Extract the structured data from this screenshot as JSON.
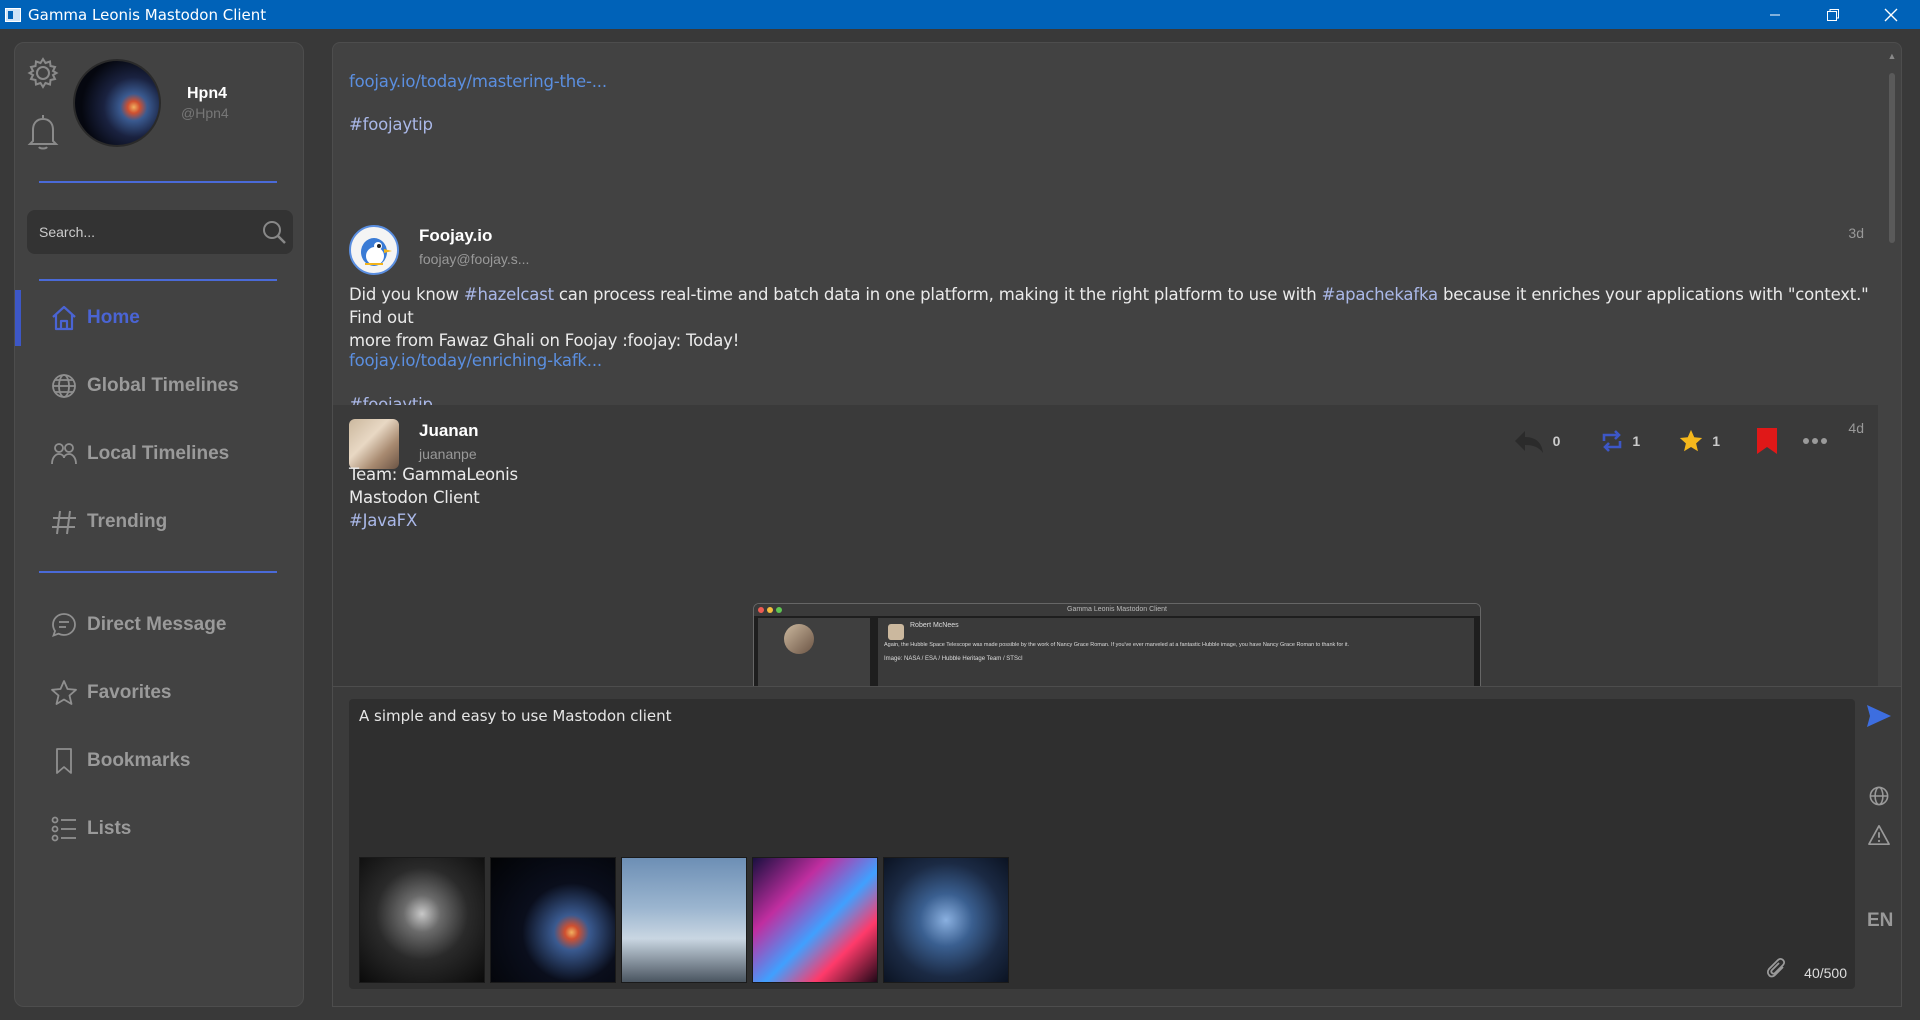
{
  "window": {
    "title": "Gamma Leonis Mastodon Client"
  },
  "profile": {
    "name": "Hpn4",
    "handle": "@Hpn4"
  },
  "search": {
    "placeholder": "Search..."
  },
  "nav": {
    "home": "Home",
    "global": "Global Timelines",
    "local": "Local Timelines",
    "trending": "Trending",
    "dm": "Direct Message",
    "favorites": "Favorites",
    "bookmarks": "Bookmarks",
    "lists": "Lists"
  },
  "posts": [
    {
      "link": "foojay.io/today/mastering-the-...",
      "hashtag": "#foojaytip"
    },
    {
      "name": "Foojay.io",
      "handle": "foojay@foojay.s...",
      "time": "3d",
      "body_1": "Did you know ",
      "tag_1": "#hazelcast",
      "body_2": " can process real-time and batch data in one platform, making it the right platform to use with ",
      "tag_2": "#apachekafka",
      "body_3": " because it enriches your applications with \"context.\" Find out",
      "body_line2": "more from Fawaz Ghali on Foojay :foojay: Today!",
      "link": "foojay.io/today/enriching-kafk...",
      "hashtag": "#foojaytip"
    },
    {
      "name": "Juanan",
      "handle": "juananpe",
      "time": "4d",
      "line1": "Team: GammaLeonis",
      "line2": "Mastodon Client",
      "hashtag": "#JavaFX",
      "replies": "0",
      "boosts": "1",
      "favs": "1",
      "preview": {
        "title": "Gamma Leonis Mastodon Client",
        "author": "Robert McNees",
        "text": "Again, the Hubble Space Telescope was made possible by the work of Nancy Grace Roman. If you've ever marveled at a fantastic Hubble image, you have Nancy Grace Roman to thank for it.",
        "credit": "Image: NASA / ESA / Hubble Heritage Team / STScI"
      }
    }
  ],
  "composer": {
    "text": "A simple and easy to use Mastodon client",
    "count": "40/500",
    "language": "EN"
  },
  "colors": {
    "accent": "#3d57c6",
    "titlebar": "#0062b8",
    "link": "#5b8fe0",
    "star": "#f5b81c",
    "bookmark": "#e01818"
  }
}
